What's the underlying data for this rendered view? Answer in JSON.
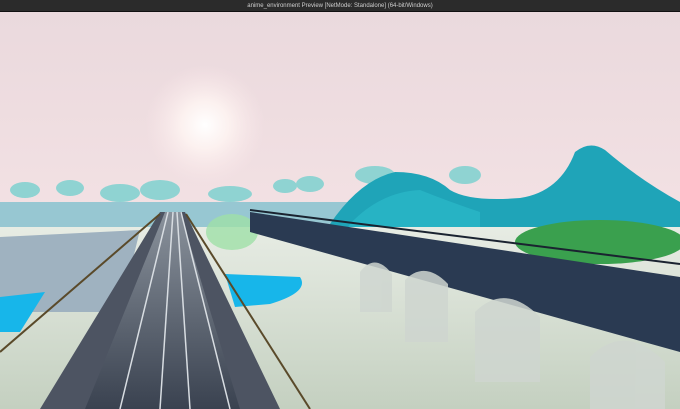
{
  "window": {
    "title": "anime_environment Preview [NetMode: Standalone] (64-bit/Windows)"
  },
  "colors": {
    "sky_top": "#f1dfe4",
    "sky_horizon": "#fde8ea",
    "hills": "#1fa4b8",
    "water": "#17b6ea",
    "fog": "#d6dfd2",
    "bridge": "#2a3a52"
  }
}
